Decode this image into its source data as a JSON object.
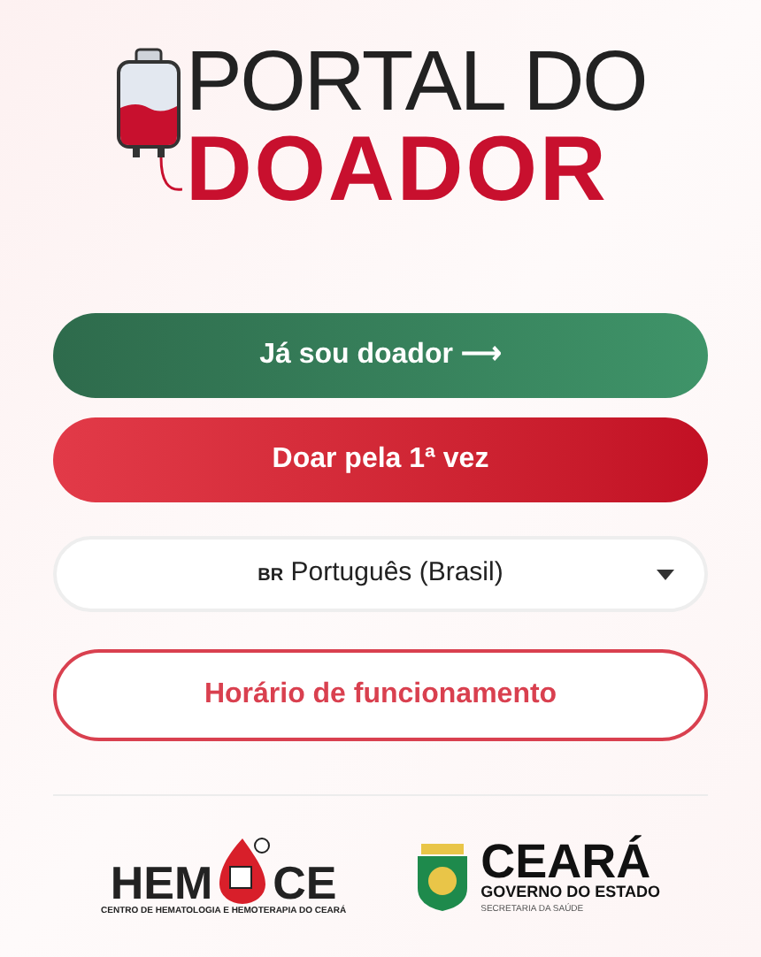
{
  "logo": {
    "line_1": "PORTAL DO",
    "line_2": "DOADOR"
  },
  "actions": [
    {
      "kind": "primary",
      "label": "Já sou doador ⟶"
    },
    {
      "kind": "danger",
      "label": "Doar pela 1ª vez"
    }
  ],
  "language_select": {
    "flag": "BR",
    "value": "Português (Brasil)"
  },
  "hours_button": {
    "label": "Horário de funcionamento"
  },
  "partners": {
    "hemoce": {
      "left": "HEM",
      "right": "CE",
      "subtitle": "CENTRO DE HEMATOLOGIA E HEMOTERAPIA DO CEARÁ"
    },
    "ceara": {
      "name": "CEARÁ",
      "line_1": "GOVERNO DO ESTADO",
      "line_2": "SECRETARIA DA SAÚDE"
    }
  }
}
